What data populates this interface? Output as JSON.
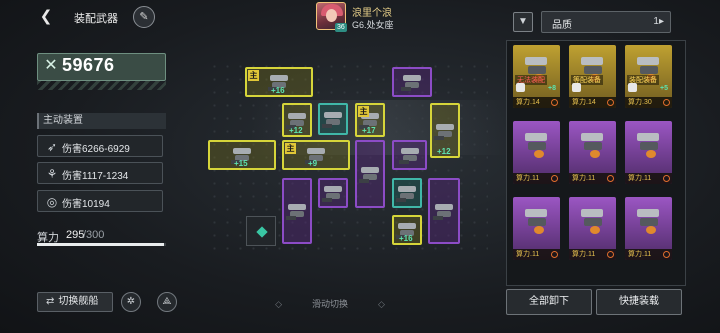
{
  "header": {
    "page_title": "装配武器",
    "back_icon": "back-arrow-icon",
    "edit_icon": "pen-icon"
  },
  "power": {
    "value": "59676",
    "icon": "crossed-swords-icon"
  },
  "active_equipment": {
    "title": "主动装置",
    "stats": [
      {
        "icon": "missile-icon",
        "text": "伤害6266-6929"
      },
      {
        "icon": "claw-icon",
        "text": "伤害1117-1234"
      },
      {
        "icon": "target-icon",
        "text": "伤害10194"
      }
    ]
  },
  "capacity": {
    "label": "算力",
    "current": "295",
    "max": "/300",
    "fraction": 0.983
  },
  "bottom_left": {
    "switch_ship_label": "切换舰船",
    "switch_icon": "swap-arrows-icon"
  },
  "swipe_hint": "滑动切换",
  "player": {
    "name": "浪里个浪",
    "title": "G6.处女座",
    "level": "36"
  },
  "grid_slots": [
    {
      "color": "yellow",
      "main": true,
      "bonus": "+16"
    },
    {
      "color": "purple",
      "main": false,
      "bonus": ""
    },
    {
      "color": "yellow",
      "main": false,
      "bonus": "+12"
    },
    {
      "color": "teal",
      "main": false,
      "bonus": ""
    },
    {
      "color": "yellow",
      "main": true,
      "bonus": "+17"
    },
    {
      "color": "yellow",
      "main": false,
      "bonus": "+12"
    },
    {
      "color": "yellow",
      "main": false,
      "bonus": "+15"
    },
    {
      "color": "yellow",
      "main": true,
      "bonus": "+9"
    },
    {
      "color": "purple",
      "main": false,
      "bonus": ""
    },
    {
      "color": "purple",
      "main": false,
      "bonus": ""
    },
    {
      "color": "purple",
      "main": false,
      "bonus": ""
    },
    {
      "color": "teal",
      "main": false,
      "bonus": ""
    },
    {
      "color": "purple",
      "main": false,
      "bonus": ""
    },
    {
      "color": "yellow",
      "main": false,
      "bonus": "+16"
    },
    {
      "color": "purple",
      "main": false,
      "bonus": ""
    }
  ],
  "right_panel": {
    "filter_icon": "filter-icon",
    "quality_label": "品质",
    "sort_icon": "sort-icon",
    "cards": [
      {
        "rarity": "y",
        "power": "算力.14",
        "note": "无法装配",
        "ok": false,
        "plus": "+8"
      },
      {
        "rarity": "y",
        "power": "算力.14",
        "note": "等配装备",
        "ok": true,
        "plus": ""
      },
      {
        "rarity": "y",
        "power": "算力.30",
        "note": "装配装备",
        "ok": true,
        "plus": "+5"
      },
      {
        "rarity": "p",
        "power": "算力.11",
        "note": "",
        "ok": true,
        "plus": ""
      },
      {
        "rarity": "p",
        "power": "算力.11",
        "note": "",
        "ok": true,
        "plus": ""
      },
      {
        "rarity": "p",
        "power": "算力.11",
        "note": "",
        "ok": true,
        "plus": ""
      },
      {
        "rarity": "p",
        "power": "算力.11",
        "note": "",
        "ok": true,
        "plus": ""
      },
      {
        "rarity": "p",
        "power": "算力.11",
        "note": "",
        "ok": true,
        "plus": ""
      },
      {
        "rarity": "p",
        "power": "算力.11",
        "note": "",
        "ok": true,
        "plus": ""
      }
    ],
    "unequip_all": "全部卸下",
    "quick_equip": "快捷装载"
  }
}
